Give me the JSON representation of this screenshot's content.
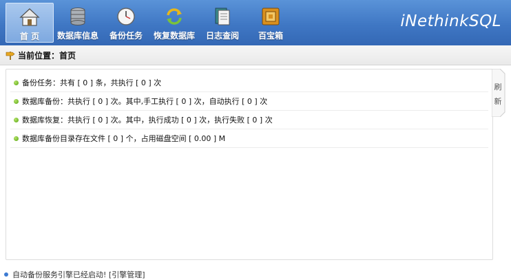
{
  "app": {
    "brand": "iNethinkSQL"
  },
  "nav": {
    "items": [
      {
        "label": "首 页",
        "icon": "home-icon",
        "active": true
      },
      {
        "label": "数据库信息",
        "icon": "database-icon",
        "active": false
      },
      {
        "label": "备份任务",
        "icon": "clock-icon",
        "active": false
      },
      {
        "label": "恢复数据库",
        "icon": "refresh-icon",
        "active": false
      },
      {
        "label": "日志查阅",
        "icon": "log-icon",
        "active": false
      },
      {
        "label": "百宝箱",
        "icon": "toolbox-icon",
        "active": false
      }
    ]
  },
  "breadcrumb": {
    "text": "当前位置：首页"
  },
  "stats": {
    "rows": [
      "备份任务：共有 [ 0 ] 条，共执行 [ 0 ] 次",
      "数据库备份：共执行 [ 0 ] 次。其中,手工执行 [ 0 ] 次，自动执行 [ 0 ] 次",
      "数据库恢复：共执行 [ 0 ] 次。其中，执行成功 [ 0 ] 次，执行失败 [ 0 ] 次",
      "数据库备份目录存在文件 [ 0 ] 个，占用磁盘空间 [ 0.00 ] M"
    ]
  },
  "refresh": {
    "label": "刷新"
  },
  "footer": {
    "text": "自动备份服务引擎已经启动! [引擎管理]"
  },
  "colors": {
    "accent": "#3f77c4",
    "dot": "#56a50f"
  }
}
